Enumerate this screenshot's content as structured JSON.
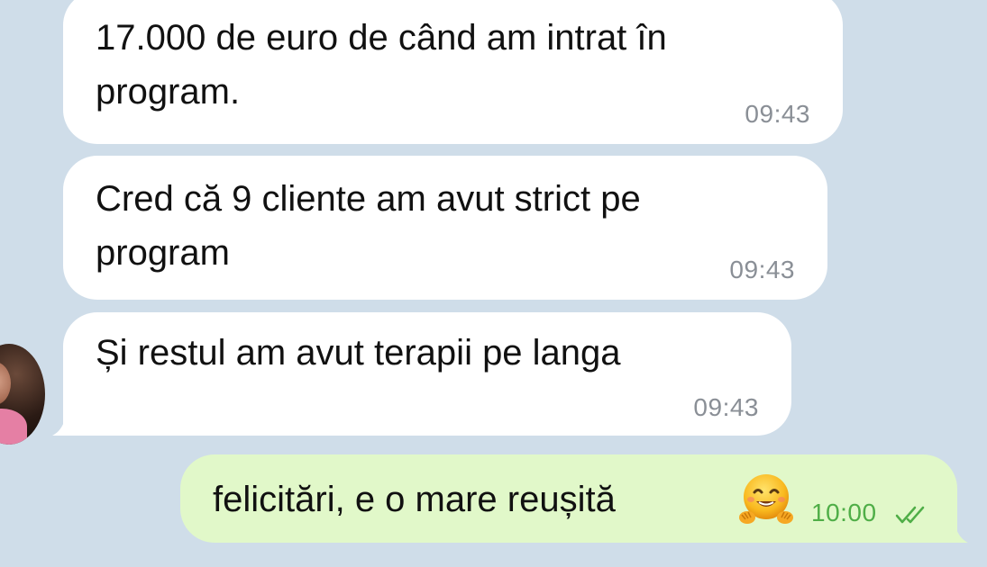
{
  "messages": [
    {
      "direction": "incoming",
      "lines": [
        "17.000 de euro de când am intrat în",
        "program."
      ],
      "time": "09:43"
    },
    {
      "direction": "incoming",
      "lines": [
        "Cred că 9 cliente am avut strict pe",
        "program"
      ],
      "time": "09:43"
    },
    {
      "direction": "incoming",
      "lines": [
        "Și restul am avut terapii pe langa"
      ],
      "time": "09:43"
    },
    {
      "direction": "outgoing",
      "text": "felicitări, e o mare reușită",
      "emoji": "hugging-face-emoji",
      "time": "10:00",
      "status_icon": "double-check-icon"
    }
  ],
  "colors": {
    "background": "#cfdde9",
    "incoming_bubble": "#ffffff",
    "outgoing_bubble": "#e1f8c9",
    "timestamp_incoming": "#8a8f96",
    "timestamp_outgoing": "#4fae47"
  }
}
